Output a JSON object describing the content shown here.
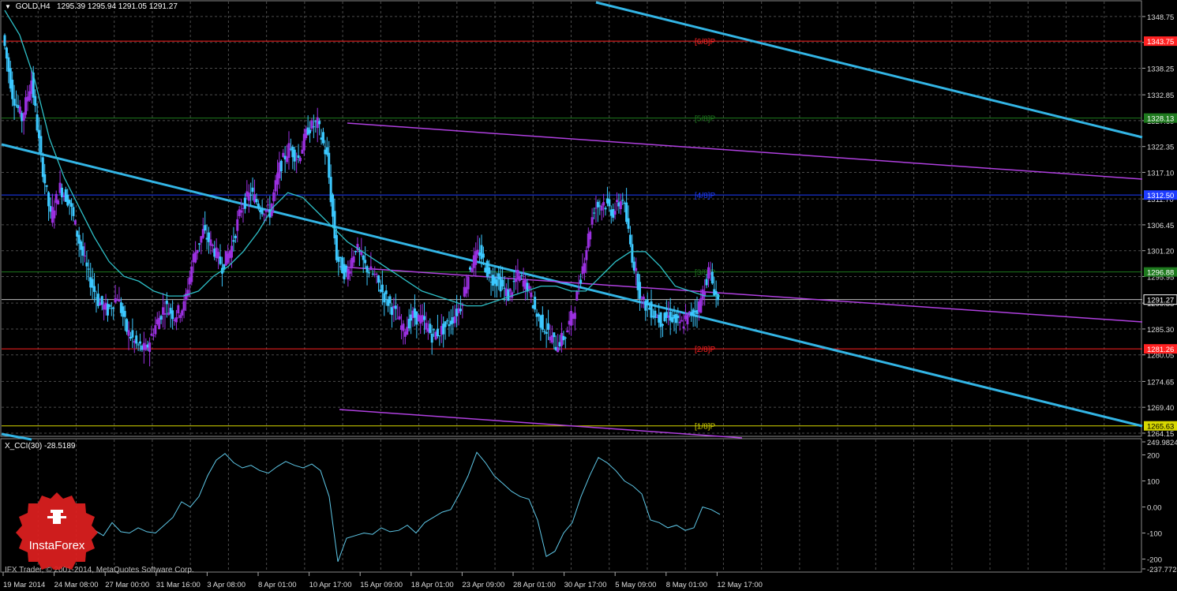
{
  "header": {
    "symbol": "GOLD,H4",
    "ohlc": "1295.39 1295.94 1291.05 1291.27"
  },
  "indicator": {
    "label": "X_CCI(30) -28.5189"
  },
  "copyright": "IFX Trader, © 2001-2014, MetaQuotes Software Corp.",
  "logo": {
    "text": "InstaForex"
  },
  "colors": {
    "background": "#000000",
    "grid": "#4b4b4b",
    "bull": "#9b30e0",
    "bear": "#3cc8ff",
    "ma": "#2ec0c8",
    "channel_blue": "#33b5e5",
    "channel_violet": "#b040e0",
    "murrey_red": "#ff2222",
    "murrey_green": "#1e7a1e",
    "murrey_blue": "#1e3cff",
    "murrey_yellow": "#d8d800",
    "cci": "#5ec8e8",
    "logo_red": "#e02020"
  },
  "chart_data": [
    {
      "type": "candlestick",
      "symbol": "GOLD",
      "timeframe": "H4",
      "y_axis_ticks": [
        "1348.75",
        "1343.50",
        "1338.25",
        "1332.85",
        "1327.60",
        "1322.35",
        "1317.10",
        "1311.70",
        "1306.45",
        "1301.20",
        "1295.95",
        "1290.55",
        "1285.30",
        "1280.05",
        "1274.65",
        "1269.40",
        "1264.15"
      ],
      "ylim": [
        1263.5,
        1350.5
      ],
      "x_axis_labels": [
        "19 Mar 2014",
        "24 Mar 08:00",
        "27 Mar 00:00",
        "31 Mar 16:00",
        "3 Apr 08:00",
        "8 Apr 01:00",
        "10 Apr 17:00",
        "15 Apr 09:00",
        "18 Apr 01:00",
        "23 Apr 09:00",
        "28 Apr 01:00",
        "30 Apr 17:00",
        "5 May 09:00",
        "8 May 01:00",
        "12 May 17:00"
      ],
      "price_labels": [
        {
          "value": "1343.75",
          "color": "murrey_red"
        },
        {
          "value": "1328.13",
          "color": "murrey_green"
        },
        {
          "value": "1312.50",
          "color": "murrey_blue"
        },
        {
          "value": "1296.88",
          "color": "murrey_green"
        },
        {
          "value": "1291.27",
          "color": "current"
        },
        {
          "value": "1281.26",
          "color": "murrey_red"
        },
        {
          "value": "1265.63",
          "color": "murrey_yellow"
        }
      ],
      "murrey_levels": [
        {
          "price": 1343.75,
          "label": "[6/8]P",
          "color": "murrey_red"
        },
        {
          "price": 1328.13,
          "label": "[5/8]P",
          "color": "murrey_green"
        },
        {
          "price": 1312.5,
          "label": "[4/8]P",
          "color": "murrey_blue"
        },
        {
          "price": 1296.88,
          "label": "[3/8]P",
          "color": "murrey_green"
        },
        {
          "price": 1281.26,
          "label": "[2/8]P",
          "color": "murrey_red"
        },
        {
          "price": 1265.63,
          "label": "[1/8]P",
          "color": "murrey_yellow"
        }
      ],
      "current_price": 1291.27,
      "close_path": [
        1345,
        1333,
        1328,
        1336,
        1320,
        1308,
        1314,
        1311,
        1303,
        1296,
        1291,
        1289,
        1292,
        1285,
        1282,
        1281,
        1286,
        1290,
        1288,
        1290,
        1300,
        1305,
        1302,
        1298,
        1302,
        1310,
        1313,
        1310,
        1309,
        1318,
        1322,
        1320,
        1326,
        1327,
        1320,
        1300,
        1296,
        1302,
        1298,
        1296,
        1292,
        1289,
        1285,
        1288,
        1287,
        1284,
        1285,
        1287,
        1290,
        1298,
        1301,
        1296,
        1295,
        1292,
        1296,
        1294,
        1288,
        1285,
        1282,
        1284,
        1290,
        1300,
        1310,
        1311,
        1309,
        1312,
        1300,
        1291,
        1289,
        1287,
        1288,
        1286,
        1288,
        1290,
        1297,
        1291
      ],
      "ma_path": [
        1350,
        1345,
        1336,
        1324,
        1316,
        1310,
        1304,
        1299,
        1296,
        1295,
        1293,
        1292,
        1292,
        1293,
        1296,
        1298,
        1301,
        1305,
        1310,
        1313,
        1312,
        1309,
        1306,
        1303,
        1301,
        1299,
        1297,
        1295,
        1293,
        1292,
        1291,
        1290,
        1290,
        1291,
        1292,
        1293,
        1294,
        1294,
        1293,
        1293,
        1296,
        1299,
        1301,
        1301,
        1298,
        1294,
        1293,
        1292,
        1292
      ],
      "cci": {
        "ylim": [
          -237.7724,
          249.9824
        ],
        "ticks": [
          "249.9824",
          "200",
          "100",
          "0.00",
          "-100",
          "-200",
          "-237.7724"
        ],
        "values": [
          -90,
          -110,
          -60,
          -95,
          -100,
          -80,
          -95,
          -100,
          -70,
          -40,
          20,
          0,
          40,
          120,
          180,
          205,
          170,
          150,
          160,
          140,
          130,
          155,
          175,
          160,
          150,
          165,
          140,
          40,
          -210,
          -120,
          -110,
          -100,
          -105,
          -80,
          -95,
          -90,
          -70,
          -100,
          -60,
          -40,
          -20,
          -10,
          50,
          120,
          210,
          170,
          120,
          90,
          60,
          40,
          30,
          -50,
          -190,
          -170,
          -100,
          -60,
          40,
          120,
          190,
          170,
          140,
          100,
          80,
          50,
          -50,
          -60,
          -80,
          -70,
          -90,
          -80,
          0,
          -10,
          -28.5
        ]
      }
    }
  ]
}
